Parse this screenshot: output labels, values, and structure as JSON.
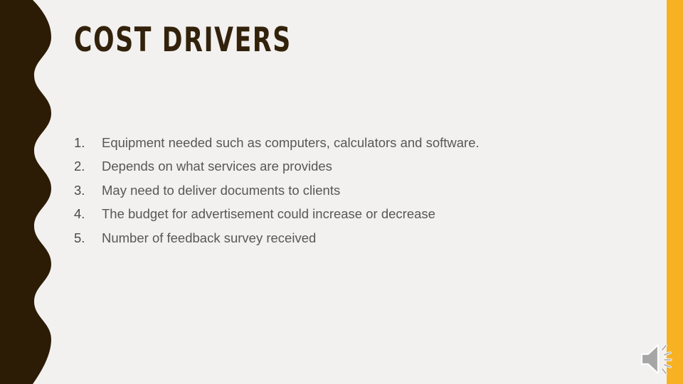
{
  "slide": {
    "title": "COST DRIVERS",
    "background_color": "#F2F1EF",
    "accent_dark_color": "#33220B",
    "accent_yellow_color": "#F7B122",
    "body_text_color": "#575757",
    "items": [
      {
        "number": "1.",
        "text": "Equipment needed such as computers, calculators and software."
      },
      {
        "number": "2.",
        "text": "Depends on what services are provides"
      },
      {
        "number": "3.",
        "text": "May need to deliver documents to clients"
      },
      {
        "number": "4.",
        "text": "The budget for advertisement could increase or decrease"
      },
      {
        "number": "5.",
        "text": "Number of feedback survey received"
      }
    ],
    "audio_icon": {
      "name": "speaker-audio-icon",
      "label": "Audio"
    }
  }
}
